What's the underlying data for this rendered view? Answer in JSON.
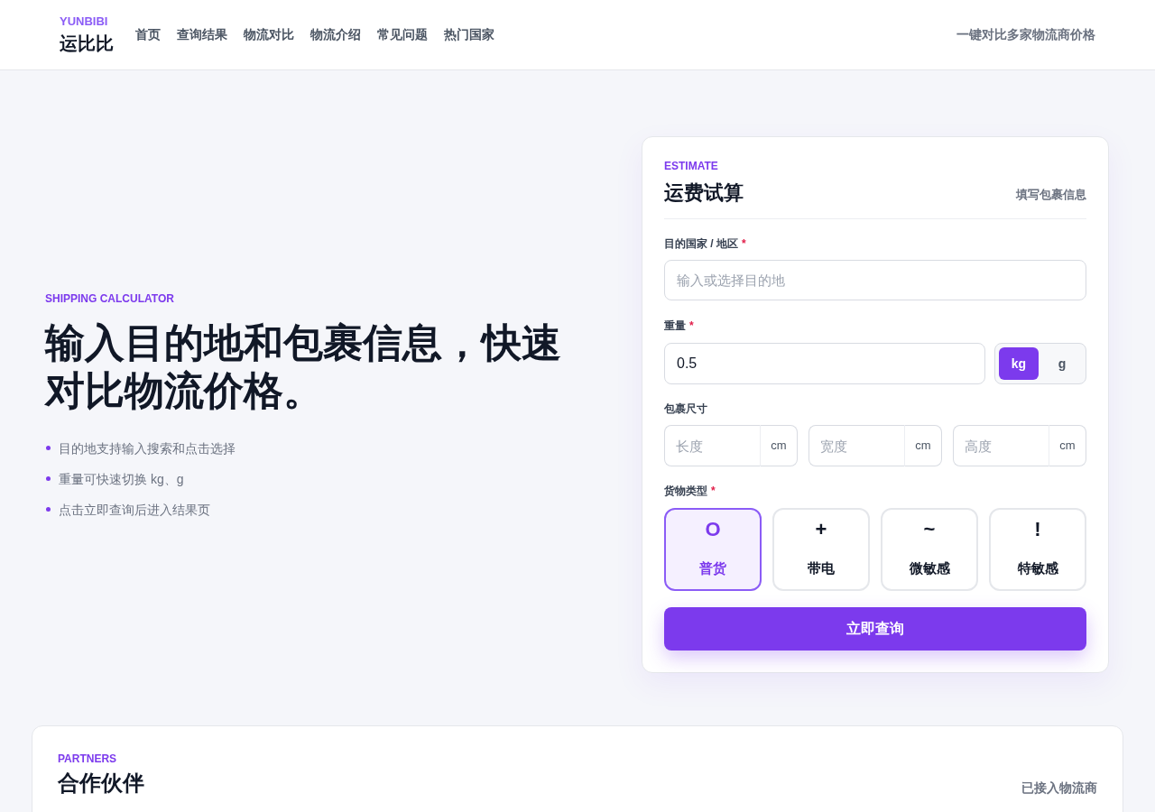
{
  "header": {
    "brand_en": "YUNBIBI",
    "brand": "运比比",
    "nav": [
      {
        "label": "首页"
      },
      {
        "label": "查询结果"
      },
      {
        "label": "物流对比"
      },
      {
        "label": "物流介绍"
      },
      {
        "label": "常见问题"
      },
      {
        "label": "热门国家"
      }
    ],
    "tagline": "一键对比多家物流商价格"
  },
  "hero": {
    "eyebrow": "SHIPPING CALCULATOR",
    "title": "输入目的地和包裹信息，快速对比物流价格。",
    "points": [
      "目的地支持输入搜索和点击选择",
      "重量可快速切换 kg、g",
      "点击立即查询后进入结果页"
    ]
  },
  "estimate": {
    "eyebrow": "ESTIMATE",
    "title": "运费试算",
    "hint": "填写包裹信息",
    "destination": {
      "label": "目的国家 / 地区",
      "required_mark": "*",
      "placeholder": "输入或选择目的地"
    },
    "weight": {
      "label": "重量",
      "required_mark": "*",
      "value": "0.5",
      "units": [
        {
          "label": "kg",
          "selected": true
        },
        {
          "label": "g",
          "selected": false
        }
      ]
    },
    "dimensions": {
      "label": "包裹尺寸",
      "fields": [
        {
          "placeholder": "长度",
          "unit": "cm"
        },
        {
          "placeholder": "宽度",
          "unit": "cm"
        },
        {
          "placeholder": "高度",
          "unit": "cm"
        }
      ]
    },
    "cargo_type": {
      "label": "货物类型",
      "required_mark": "*",
      "options": [
        {
          "symbol": "O",
          "label": "普货",
          "selected": true
        },
        {
          "symbol": "+",
          "label": "带电",
          "selected": false
        },
        {
          "symbol": "~",
          "label": "微敏感",
          "selected": false
        },
        {
          "symbol": "!",
          "label": "特敏感",
          "selected": false
        }
      ]
    },
    "submit": "立即查询"
  },
  "partners": {
    "eyebrow": "PARTNERS",
    "title": "合作伙伴",
    "note": "已接入物流商"
  }
}
